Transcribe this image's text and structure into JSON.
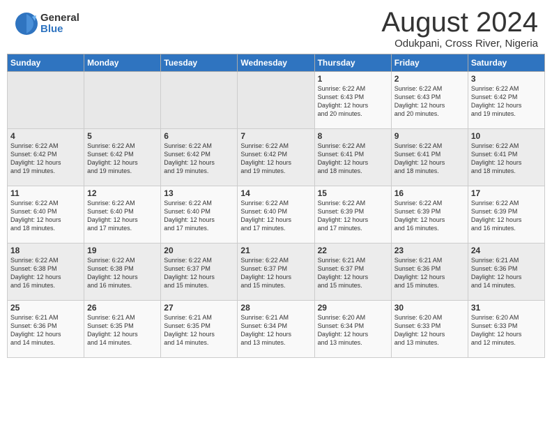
{
  "header": {
    "logo_general": "General",
    "logo_blue": "Blue",
    "month_title": "August 2024",
    "location": "Odukpani, Cross River, Nigeria"
  },
  "weekdays": [
    "Sunday",
    "Monday",
    "Tuesday",
    "Wednesday",
    "Thursday",
    "Friday",
    "Saturday"
  ],
  "weeks": [
    [
      {
        "day": "",
        "info": ""
      },
      {
        "day": "",
        "info": ""
      },
      {
        "day": "",
        "info": ""
      },
      {
        "day": "",
        "info": ""
      },
      {
        "day": "1",
        "info": "Sunrise: 6:22 AM\nSunset: 6:43 PM\nDaylight: 12 hours\nand 20 minutes."
      },
      {
        "day": "2",
        "info": "Sunrise: 6:22 AM\nSunset: 6:43 PM\nDaylight: 12 hours\nand 20 minutes."
      },
      {
        "day": "3",
        "info": "Sunrise: 6:22 AM\nSunset: 6:42 PM\nDaylight: 12 hours\nand 19 minutes."
      }
    ],
    [
      {
        "day": "4",
        "info": "Sunrise: 6:22 AM\nSunset: 6:42 PM\nDaylight: 12 hours\nand 19 minutes."
      },
      {
        "day": "5",
        "info": "Sunrise: 6:22 AM\nSunset: 6:42 PM\nDaylight: 12 hours\nand 19 minutes."
      },
      {
        "day": "6",
        "info": "Sunrise: 6:22 AM\nSunset: 6:42 PM\nDaylight: 12 hours\nand 19 minutes."
      },
      {
        "day": "7",
        "info": "Sunrise: 6:22 AM\nSunset: 6:42 PM\nDaylight: 12 hours\nand 19 minutes."
      },
      {
        "day": "8",
        "info": "Sunrise: 6:22 AM\nSunset: 6:41 PM\nDaylight: 12 hours\nand 18 minutes."
      },
      {
        "day": "9",
        "info": "Sunrise: 6:22 AM\nSunset: 6:41 PM\nDaylight: 12 hours\nand 18 minutes."
      },
      {
        "day": "10",
        "info": "Sunrise: 6:22 AM\nSunset: 6:41 PM\nDaylight: 12 hours\nand 18 minutes."
      }
    ],
    [
      {
        "day": "11",
        "info": "Sunrise: 6:22 AM\nSunset: 6:40 PM\nDaylight: 12 hours\nand 18 minutes."
      },
      {
        "day": "12",
        "info": "Sunrise: 6:22 AM\nSunset: 6:40 PM\nDaylight: 12 hours\nand 17 minutes."
      },
      {
        "day": "13",
        "info": "Sunrise: 6:22 AM\nSunset: 6:40 PM\nDaylight: 12 hours\nand 17 minutes."
      },
      {
        "day": "14",
        "info": "Sunrise: 6:22 AM\nSunset: 6:40 PM\nDaylight: 12 hours\nand 17 minutes."
      },
      {
        "day": "15",
        "info": "Sunrise: 6:22 AM\nSunset: 6:39 PM\nDaylight: 12 hours\nand 17 minutes."
      },
      {
        "day": "16",
        "info": "Sunrise: 6:22 AM\nSunset: 6:39 PM\nDaylight: 12 hours\nand 16 minutes."
      },
      {
        "day": "17",
        "info": "Sunrise: 6:22 AM\nSunset: 6:39 PM\nDaylight: 12 hours\nand 16 minutes."
      }
    ],
    [
      {
        "day": "18",
        "info": "Sunrise: 6:22 AM\nSunset: 6:38 PM\nDaylight: 12 hours\nand 16 minutes."
      },
      {
        "day": "19",
        "info": "Sunrise: 6:22 AM\nSunset: 6:38 PM\nDaylight: 12 hours\nand 16 minutes."
      },
      {
        "day": "20",
        "info": "Sunrise: 6:22 AM\nSunset: 6:37 PM\nDaylight: 12 hours\nand 15 minutes."
      },
      {
        "day": "21",
        "info": "Sunrise: 6:22 AM\nSunset: 6:37 PM\nDaylight: 12 hours\nand 15 minutes."
      },
      {
        "day": "22",
        "info": "Sunrise: 6:21 AM\nSunset: 6:37 PM\nDaylight: 12 hours\nand 15 minutes."
      },
      {
        "day": "23",
        "info": "Sunrise: 6:21 AM\nSunset: 6:36 PM\nDaylight: 12 hours\nand 15 minutes."
      },
      {
        "day": "24",
        "info": "Sunrise: 6:21 AM\nSunset: 6:36 PM\nDaylight: 12 hours\nand 14 minutes."
      }
    ],
    [
      {
        "day": "25",
        "info": "Sunrise: 6:21 AM\nSunset: 6:36 PM\nDaylight: 12 hours\nand 14 minutes."
      },
      {
        "day": "26",
        "info": "Sunrise: 6:21 AM\nSunset: 6:35 PM\nDaylight: 12 hours\nand 14 minutes."
      },
      {
        "day": "27",
        "info": "Sunrise: 6:21 AM\nSunset: 6:35 PM\nDaylight: 12 hours\nand 14 minutes."
      },
      {
        "day": "28",
        "info": "Sunrise: 6:21 AM\nSunset: 6:34 PM\nDaylight: 12 hours\nand 13 minutes."
      },
      {
        "day": "29",
        "info": "Sunrise: 6:20 AM\nSunset: 6:34 PM\nDaylight: 12 hours\nand 13 minutes."
      },
      {
        "day": "30",
        "info": "Sunrise: 6:20 AM\nSunset: 6:33 PM\nDaylight: 12 hours\nand 13 minutes."
      },
      {
        "day": "31",
        "info": "Sunrise: 6:20 AM\nSunset: 6:33 PM\nDaylight: 12 hours\nand 12 minutes."
      }
    ]
  ]
}
